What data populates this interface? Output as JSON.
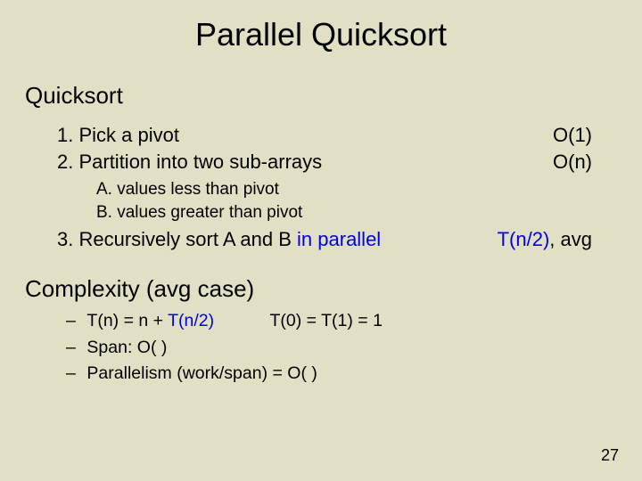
{
  "title": "Parallel Quicksort",
  "subtitle": "Quicksort",
  "steps": {
    "s1": {
      "text": "1. Pick a pivot",
      "cost": "O(1)"
    },
    "s2": {
      "text": "2. Partition into two sub-arrays",
      "cost": "O(n)"
    },
    "sub": {
      "a": "A. values less than pivot",
      "b": "B. values greater than pivot"
    },
    "s3": {
      "prefix": "3. Recursively sort A and B ",
      "blue": "in parallel",
      "cost_blue": "T(n/2)",
      "cost_suffix": ", avg"
    }
  },
  "complexity": {
    "head": "Complexity (avg case)",
    "l1": {
      "dash": "–",
      "prefix": "T(n) = n + ",
      "blue": "T(n/2)",
      "right": "T(0) = T(1) = 1"
    },
    "l2": {
      "dash": "–",
      "text": "Span:  O(        )"
    },
    "l3": {
      "dash": "–",
      "text": "Parallelism (work/span) = O(             )"
    }
  },
  "page": "27"
}
